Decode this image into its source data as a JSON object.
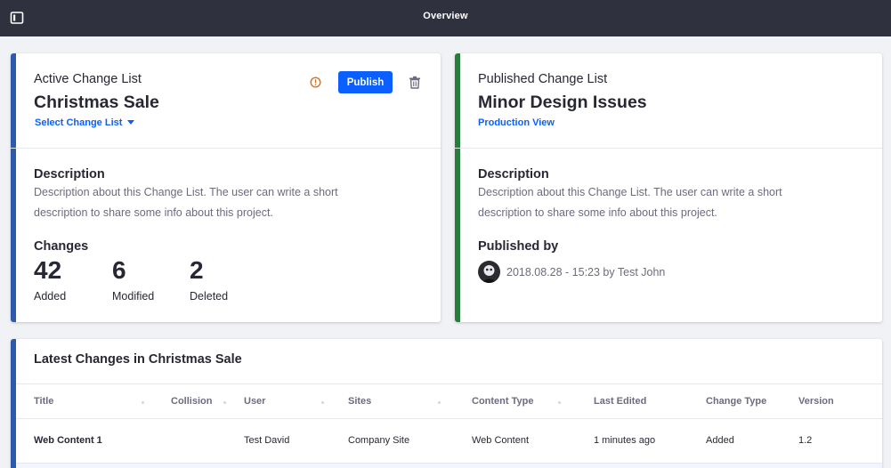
{
  "topbar": {
    "title": "Overview",
    "sidebar_icon": "sidebar-toggle-icon"
  },
  "active_card": {
    "eyebrow": "Active Change List",
    "title": "Christmas Sale",
    "select_link": "Select Change List",
    "publish_label": "Publish",
    "accent_color": "#2e5aac",
    "description_heading": "Description",
    "description": "Description about this Change List. The user can write a short description to share some info about this project.",
    "changes_heading": "Changes",
    "stats": [
      {
        "value": "42",
        "label": "Added"
      },
      {
        "value": "6",
        "label": "Modified"
      },
      {
        "value": "2",
        "label": "Deleted"
      }
    ]
  },
  "published_card": {
    "eyebrow": "Published Change List",
    "title": "Minor Design Issues",
    "production_link": "Production View",
    "accent_color": "#287d3c",
    "description_heading": "Description",
    "description": "Description about this Change List. The user can write a short description to share some info about this project.",
    "published_by_heading": "Published by",
    "published_meta": "2018.08.28 - 15:23 by Test John"
  },
  "latest_changes": {
    "title": "Latest Changes in Christmas Sale",
    "columns": [
      "Title",
      "Collision",
      "User",
      "Sites",
      "Content Type",
      "Last Edited",
      "Change Type",
      "Version"
    ],
    "rows": [
      [
        "Web Content 1",
        "",
        "Test David",
        "Company Site",
        "Web Content",
        "1 minutes ago",
        "Added",
        "1.2"
      ]
    ]
  }
}
